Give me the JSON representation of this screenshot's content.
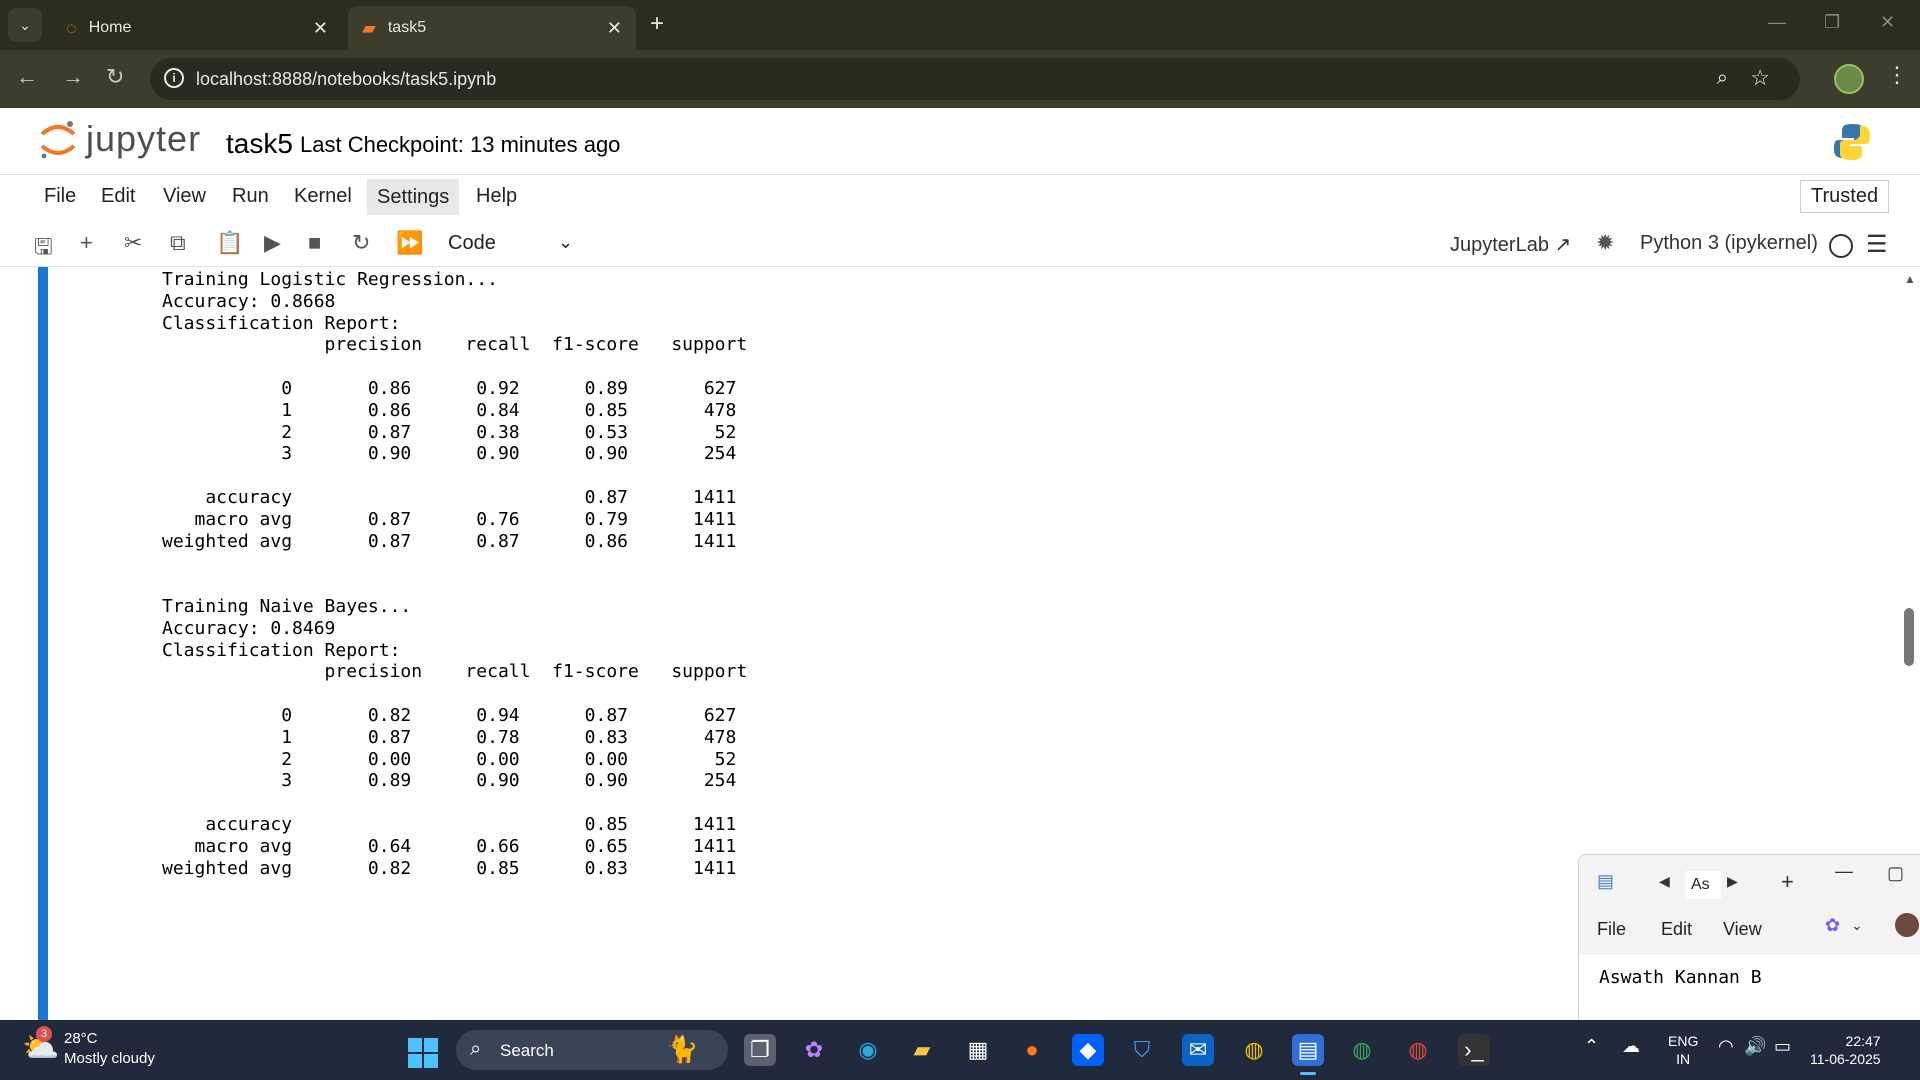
{
  "browser": {
    "tabs": [
      {
        "label": "Home",
        "active": false
      },
      {
        "label": "task5",
        "active": true
      }
    ],
    "url": "localhost:8888/notebooks/task5.ipynb"
  },
  "jupyter": {
    "logo_text": "jupyter",
    "notebook_name": "task5",
    "checkpoint": "Last Checkpoint: 13 minutes ago",
    "trusted": "Trusted",
    "menu": [
      "File",
      "Edit",
      "View",
      "Run",
      "Kernel",
      "Settings",
      "Help"
    ],
    "cell_type": "Code",
    "jupyterlab_label": "JupyterLab",
    "kernel_label": "Python 3 (ipykernel)"
  },
  "output": {
    "lines": [
      "Training Logistic Regression...",
      "Accuracy: 0.8668",
      "Classification Report:",
      "               precision    recall  f1-score   support",
      "",
      "           0       0.86      0.92      0.89       627",
      "           1       0.86      0.84      0.85       478",
      "           2       0.87      0.38      0.53        52",
      "           3       0.90      0.90      0.90       254",
      "",
      "    accuracy                           0.87      1411",
      "   macro avg       0.87      0.76      0.79      1411",
      "weighted avg       0.87      0.87      0.86      1411",
      "",
      "",
      "Training Naive Bayes...",
      "Accuracy: 0.8469",
      "Classification Report:",
      "               precision    recall  f1-score   support",
      "",
      "           0       0.82      0.94      0.87       627",
      "           1       0.87      0.78      0.83       478",
      "           2       0.00      0.00      0.00        52",
      "           3       0.89      0.90      0.90       254",
      "",
      "    accuracy                           0.85      1411",
      "   macro avg       0.64      0.66      0.65      1411",
      "weighted avg       0.82      0.85      0.83      1411"
    ]
  },
  "notepad": {
    "tab_label": "As",
    "menu": [
      "File",
      "Edit",
      "View"
    ],
    "text": "Aswath Kannan B"
  },
  "taskbar": {
    "weather_badge": "3",
    "temperature": "28°C",
    "condition": "Mostly cloudy",
    "search_label": "Search",
    "lang_top": "ENG",
    "lang_bottom": "IN",
    "time": "22:47",
    "date": "11-06-2025"
  }
}
